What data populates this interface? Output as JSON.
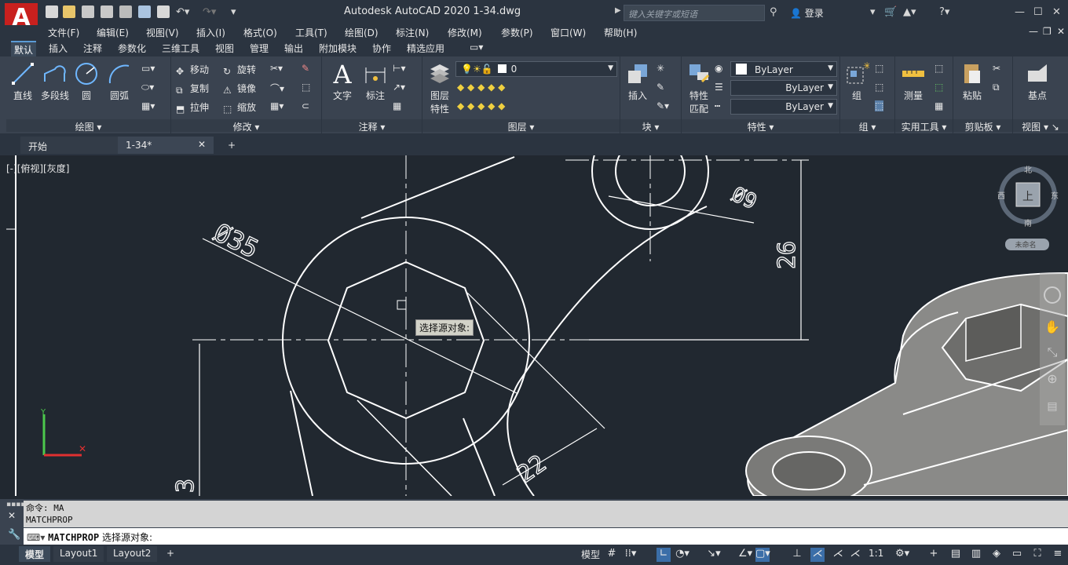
{
  "app": {
    "logo_letter": "A",
    "title": "Autodesk AutoCAD 2020    1-34.dwg",
    "search_placeholder": "键入关键字或短语",
    "signin_label": "登录"
  },
  "menu": [
    "文件(F)",
    "编辑(E)",
    "视图(V)",
    "插入(I)",
    "格式(O)",
    "工具(T)",
    "绘图(D)",
    "标注(N)",
    "修改(M)",
    "参数(P)",
    "窗口(W)",
    "帮助(H)"
  ],
  "ribbon_tabs": [
    "默认",
    "插入",
    "注释",
    "参数化",
    "三维工具",
    "视图",
    "管理",
    "输出",
    "附加模块",
    "协作",
    "精选应用"
  ],
  "ribbon": {
    "draw": {
      "title": "绘图",
      "line": "直线",
      "polyline": "多段线",
      "circle": "圆",
      "arc": "圆弧"
    },
    "modify": {
      "title": "修改",
      "move": "移动",
      "rotate": "旋转",
      "copy": "复制",
      "mirror": "镜像",
      "stretch": "拉伸",
      "scale": "缩放"
    },
    "annotation": {
      "title": "注释",
      "text": "文字",
      "dimension": "标注"
    },
    "layers": {
      "title": "图层",
      "layer_props_1": "图层",
      "layer_props_2": "特性",
      "current_layer": "0"
    },
    "block": {
      "title": "块",
      "insert": "插入"
    },
    "properties": {
      "title": "特性",
      "match_1": "特性",
      "match_2": "匹配",
      "color": "ByLayer",
      "linetype": "ByLayer",
      "lineweight": "ByLayer"
    },
    "groups": {
      "title": "组",
      "group": "组"
    },
    "utilities": {
      "title": "实用工具",
      "measure": "测量"
    },
    "clipboard": {
      "title": "剪贴板",
      "paste": "粘贴"
    },
    "view": {
      "title": "视图",
      "base": "基点"
    }
  },
  "doc_tabs": {
    "start": "开始",
    "file": "1-34*"
  },
  "viewport": {
    "label": "[-][俯视][灰度]",
    "tooltip": "选择源对象:",
    "dims": {
      "d35": "Ø35",
      "d9": "Ø9",
      "d26": "26",
      "d22": "22",
      "d3": "3"
    },
    "viewcube": {
      "north": "北",
      "south": "南",
      "east": "东",
      "west": "西",
      "top": "上",
      "ucs": "未命名"
    }
  },
  "command": {
    "history_1": "命令: MA",
    "history_2": "MATCHPROP",
    "prompt_cmd": "MATCHPROP",
    "prompt_text": "选择源对象:"
  },
  "status": {
    "tabs": [
      "模型",
      "Layout1",
      "Layout2"
    ],
    "model_label": "模型",
    "scale": "1:1"
  }
}
